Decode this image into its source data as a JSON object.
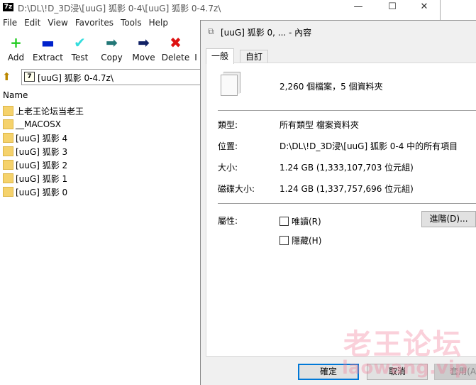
{
  "zip": {
    "title": "D:\\DL\\!D_3D浸\\[uuG] 狐影 0-4\\[uuG] 狐影 0-4.7z\\",
    "menu": [
      "File",
      "Edit",
      "View",
      "Favorites",
      "Tools",
      "Help"
    ],
    "toolbar": [
      {
        "label": "Add",
        "icon": "+",
        "color": "#22cc22"
      },
      {
        "label": "Extract",
        "icon": "▬",
        "color": "#0022cc"
      },
      {
        "label": "Test",
        "icon": "✔",
        "color": "#33dddd"
      },
      {
        "label": "Copy",
        "icon": "➡",
        "color": "#227777"
      },
      {
        "label": "Move",
        "icon": "➡",
        "color": "#112266"
      },
      {
        "label": "Delete",
        "icon": "✖",
        "color": "#dd1111"
      },
      {
        "label": "I",
        "icon": "",
        "color": "#000"
      }
    ],
    "address": "[uuG] 狐影 0-4.7z\\",
    "column_name": "Name",
    "items": [
      "上老王论坛当老王",
      "__MACOSX",
      "[uuG] 狐影 4",
      "[uuG] 狐影 3",
      "[uuG] 狐影 2",
      "[uuG] 狐影 1",
      "[uuG] 狐影 0"
    ]
  },
  "dialog": {
    "title": "[uuG] 狐影 0, ... - 內容",
    "tabs": [
      "一般",
      "自訂"
    ],
    "summary": "2,260 個檔案，5 個資料夾",
    "type_label": "類型:",
    "type_value": "所有類型 檔案資料夾",
    "location_label": "位置:",
    "location_value": "D:\\DL\\!D_3D浸\\[uuG] 狐影 0-4 中的所有項目",
    "size_label": "大小:",
    "size_value": "1.24 GB (1,333,107,703 位元組)",
    "disk_label": "磁碟大小:",
    "disk_value": "1.24 GB (1,337,757,696 位元組)",
    "attr_label": "屬性:",
    "readonly": "唯讀(R)",
    "hidden": "隱藏(H)",
    "advanced": "進階(D)...",
    "ok": "確定",
    "cancel": "取消",
    "apply": "套用(A)"
  },
  "watermark": {
    "cn": "老王论坛",
    "en": "laowang.vip"
  }
}
